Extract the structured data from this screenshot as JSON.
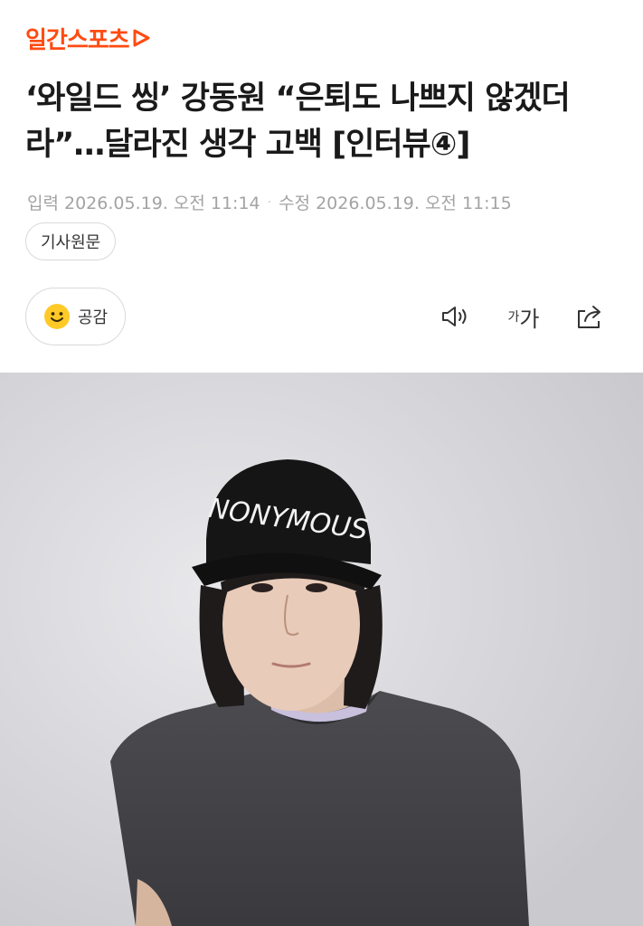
{
  "logo": {
    "text": "일간스포츠",
    "color": "#ff4b12"
  },
  "article": {
    "title": "‘와일드 씽’ 강동원 “은퇴도 나쁘지 않겠더라”…달라진 생각 고백 [인터뷰④]",
    "published_label": "입력 2026.05.19. 오전 11:14",
    "modified_label": "수정 2026.05.19. 오전 11:15",
    "separator": "·"
  },
  "buttons": {
    "source_label": "기사원문",
    "like_label": "공감",
    "font_small": "가",
    "font_big": "가"
  },
  "icons": {
    "smiley": "smiley-face-icon",
    "audio": "speaker-icon",
    "font_size": "font-size-icon",
    "share": "share-icon"
  },
  "photo": {
    "description_alt": "",
    "cap_text": "NONYMOUS"
  }
}
